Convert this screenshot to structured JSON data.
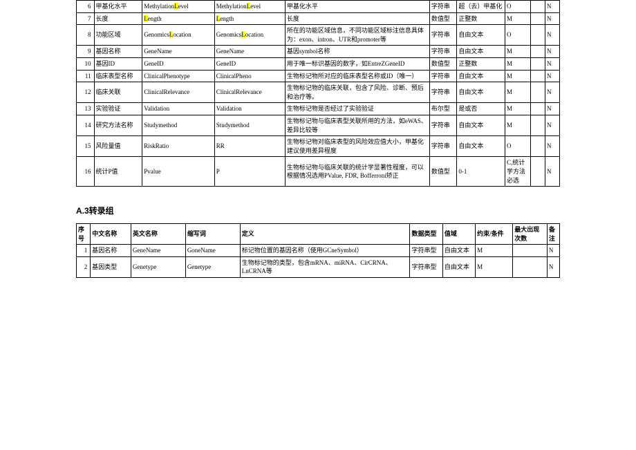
{
  "table1": {
    "rows": [
      {
        "n": "6",
        "cn": "甲基化水平",
        "en_pre": "Methylation",
        "en_hl": "L",
        "en_post": "evel",
        "ab_pre": "Methylation",
        "ab_hl": "L",
        "ab_post": "evel",
        "def": "甲基化水平",
        "dt": "字符串",
        "range": "超（去）甲基化",
        "req": "O",
        "max": "",
        "last": "N"
      },
      {
        "n": "7",
        "cn": "长度",
        "en_pre": "",
        "en_hl": "L",
        "en_post": "ength",
        "ab_pre": "",
        "ab_hl": "L",
        "ab_post": "ength",
        "def": "长度",
        "dt": "数值型",
        "range": "正整数",
        "req": "M",
        "max": "",
        "last": "N"
      },
      {
        "n": "8",
        "cn": "功能区域",
        "en_pre": "Genomics",
        "en_hl": "L",
        "en_post": "ocation",
        "ab_pre": "Genomics",
        "ab_hl": "L",
        "ab_post": "ocation",
        "def": "所在的功能区域信息，不同功能区域标注信息具体为：exon、intron、UTR和promoter等",
        "dt": "字符串",
        "range": "自由文本",
        "req": "O",
        "max": "",
        "last": "N"
      },
      {
        "n": "9",
        "cn": "基因名称",
        "en": "GeneName",
        "ab": "GeneName",
        "def": "基因symbol名称",
        "dt": "字符串",
        "range": "自由文本",
        "req": "M",
        "max": "",
        "last": "N"
      },
      {
        "n": "10",
        "cn": "基因ID",
        "en": "GeneID",
        "ab": "GeneID",
        "def": "用于唯一标识基因的数字，如EntreZGeneID",
        "dt": "数值型",
        "range": "正整数",
        "req": "M",
        "max": "",
        "last": "N"
      },
      {
        "n": "11",
        "cn": "临床表型名称",
        "en": "ClinicalPhenotype",
        "ab": "ClinicalPheno",
        "def": "生物标记物所对应的临床表型名称或ID（唯一）",
        "dt": "字符串",
        "range": "自由文本",
        "req": "M",
        "max": "",
        "last": "N"
      },
      {
        "n": "12",
        "cn": "临床关联",
        "en": "ClinicalRelevance",
        "ab": "ClinicalRelevance",
        "def": "生物标记物的临床关联，包含了风险、诊断、预后和治疗等。",
        "dt": "字符串",
        "range": "自由文本",
        "req": "M",
        "max": "",
        "last": "N"
      },
      {
        "n": "13",
        "cn": "实验验证",
        "en": "Validation",
        "ab": "Validation",
        "def": "生物标记物是否经过了实验验证",
        "dt": "布尔型",
        "range": "是或否",
        "req": "M",
        "max": "",
        "last": "N"
      },
      {
        "n": "14",
        "cn": "研究方法名称",
        "en": "Studymethod",
        "ab": "Studymethod",
        "def": "生物标记物与临床表型关联所用的方法，如eWAS、差异比较等",
        "dt": "字符串",
        "range": "自由文本",
        "req": "M",
        "max": "",
        "last": "N"
      },
      {
        "n": "15",
        "cn": "风险量值",
        "en": "RiskRatio",
        "ab": "RR",
        "def": "生物标记物对临床表型的风险效应值大小，甲基化建议使用差异程度",
        "dt": "字符串",
        "range": "自由文本",
        "req": "O",
        "max": "",
        "last": "N"
      },
      {
        "n": "16",
        "cn": "统计P值",
        "en": "Pvalue",
        "ab": "P",
        "def": "生物标记物与临床关联的统计学显著性程度，可以根据情况选用PValue, FDR, Bofferroni矫正",
        "dt": "数值型",
        "range": "0-1",
        "req": "C,统计学方法必选",
        "max": "",
        "last": "N"
      }
    ]
  },
  "section_title": "A.3转录组",
  "table2": {
    "headers": {
      "h0": "序号",
      "h1": "中文名称",
      "h2": "英文名称",
      "h3": "缩写词",
      "h4": "定义",
      "h5": "数据类型",
      "h6": "值域",
      "h7": "约束/条件",
      "h8": "最大出现次数",
      "h9": "备注"
    },
    "rows": [
      {
        "n": "1",
        "cn": "基因名称",
        "en": "GeneName",
        "ab": "GoneName",
        "def": "标记物位置的基因名称（使用GCneSymbol）",
        "dt": "字符串型",
        "range": "自由文本",
        "req": "M",
        "max": "",
        "last": "N"
      },
      {
        "n": "2",
        "cn": "基因类型",
        "en": "Genetype",
        "ab": "Genetype",
        "def": "生物标记物的类型，包含mRNA、miRNA、CirCRNA、LnCRNA等",
        "dt": "字符串型",
        "range": "自由文本",
        "req": "M",
        "max": "",
        "last": "N"
      }
    ]
  }
}
